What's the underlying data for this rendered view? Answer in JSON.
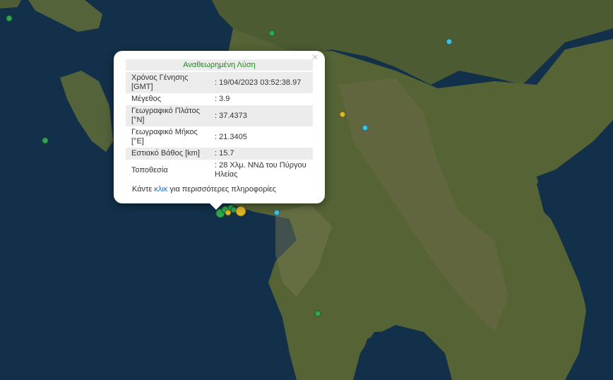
{
  "popup": {
    "title": "Αναθεωρημένη Λύση",
    "close_glyph": "×",
    "rows": [
      {
        "label": "Χρόνος Γένησης [GMT]",
        "value": ": 19/04/2023 03:52:38.97"
      },
      {
        "label": "Μέγεθος",
        "value": ": 3.9"
      },
      {
        "label": "Γεωγραφικό Πλάτος [°N]",
        "value": ": 37.4373"
      },
      {
        "label": "Γεωγραφικό Μήκος [°E]",
        "value": ": 21.3405"
      },
      {
        "label": "Εστιακό Βάθος [km]",
        "value": ": 15.7"
      },
      {
        "label": "Τοποθεσία",
        "value": ": 28 Χλμ. ΝΝΔ του Πύργου Ηλείας"
      }
    ],
    "more_prefix": "Κάντε ",
    "more_link": "κλικ",
    "more_suffix": " για περισσότερες πληροφορίες"
  },
  "map": {
    "sea_color": "#13304a",
    "land_color": "#4a5a30",
    "marker_colors": {
      "green": "#2fa84f",
      "cyan": "#3fc1d9",
      "yellow": "#e0b62a"
    }
  }
}
